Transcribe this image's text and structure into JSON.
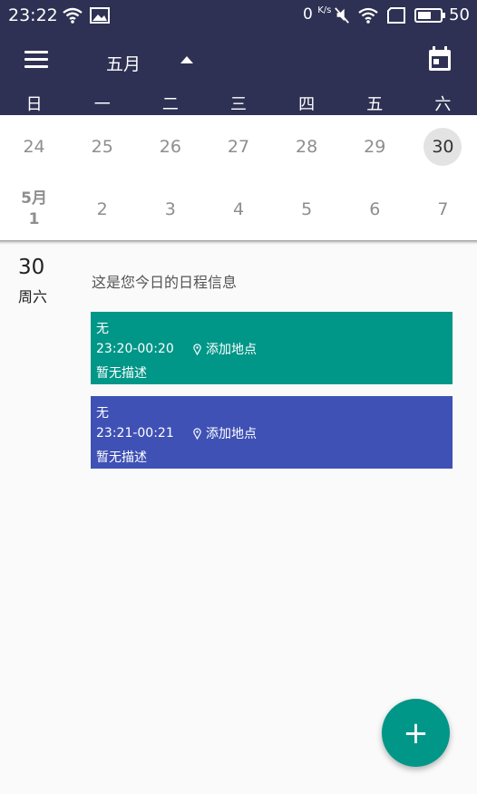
{
  "status_bar": {
    "time": "23:22",
    "net_speed": "0",
    "net_unit": "K/s",
    "battery": "50"
  },
  "toolbar": {
    "month": "五月"
  },
  "weekdays": [
    "日",
    "一",
    "二",
    "三",
    "四",
    "五",
    "六"
  ],
  "weeks": [
    [
      "24",
      "25",
      "26",
      "27",
      "28",
      "29",
      "30"
    ],
    [
      "2",
      "3",
      "4",
      "5",
      "6",
      "7"
    ]
  ],
  "month_start": {
    "month": "5月",
    "day": "1"
  },
  "selected_day": {
    "number": "30",
    "weekday": "周六"
  },
  "intro_text": "这是您今日的日程信息",
  "events": [
    {
      "title": "无",
      "time": "23:20-00:20",
      "location": "添加地点",
      "description": "暂无描述",
      "color": "#009688"
    },
    {
      "title": "无",
      "time": "23:21-00:21",
      "location": "添加地点",
      "description": "暂无描述",
      "color": "#3f51b5"
    }
  ],
  "fab": {
    "label": "+",
    "color": "#009688"
  },
  "colors": {
    "header": "#2e3153",
    "selected_circle": "#e3e3e3"
  }
}
